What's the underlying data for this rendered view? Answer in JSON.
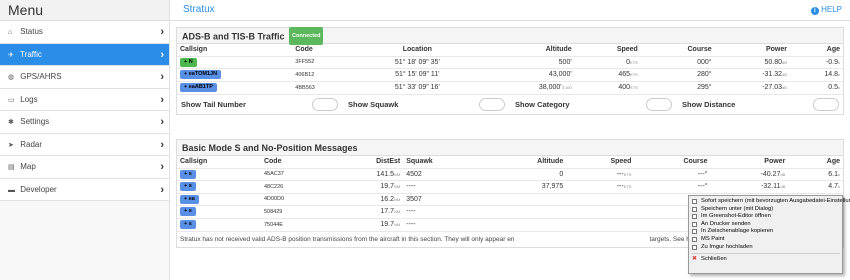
{
  "sidebar": {
    "title": "Menu",
    "items": [
      {
        "label": "Status",
        "icon": "home-icon",
        "glyph": "⌂",
        "active": false
      },
      {
        "label": "Traffic",
        "icon": "plane-icon",
        "glyph": "✈",
        "active": true
      },
      {
        "label": "GPS/AHRS",
        "icon": "globe-icon",
        "glyph": "◍",
        "active": false
      },
      {
        "label": "Logs",
        "icon": "file-icon",
        "glyph": "▭",
        "active": false
      },
      {
        "label": "Settings",
        "icon": "gear-icon",
        "glyph": "✱",
        "active": false
      },
      {
        "label": "Radar",
        "icon": "location-arrow-icon",
        "glyph": "➤",
        "active": false
      },
      {
        "label": "Map",
        "icon": "map-icon",
        "glyph": "▤",
        "active": false
      },
      {
        "label": "Developer",
        "icon": "terminal-icon",
        "glyph": "▬",
        "active": false
      }
    ],
    "chevron": "›"
  },
  "header": {
    "title": "Stratux",
    "help_label": "HELP",
    "help_glyph": "i"
  },
  "adsb": {
    "title": "ADS-B and TIS-B Traffic",
    "status_badge": "Connected",
    "columns": [
      "Callsign",
      "Code",
      "Location",
      "Altitude",
      "Speed",
      "Course",
      "Power",
      "Age"
    ],
    "rows": [
      {
        "callsign": "+ N",
        "color": "green",
        "code": "3FF552",
        "location": "51° 18' 09\" 35'",
        "altitude": "500'",
        "alt_extra": "",
        "speed": "0",
        "course": "000°",
        "power": "50.80",
        "age": "-0.9"
      },
      {
        "callsign": "+ eaTOM1JN",
        "color": "blue",
        "code": "406B12",
        "location": "51° 15' 09\" 11'",
        "altitude": "43,000'",
        "alt_extra": "",
        "speed": "465",
        "course": "280°",
        "power": "-31.32",
        "age": "14.8"
      },
      {
        "callsign": "+ eaAB1TP",
        "color": "blue",
        "code": "4BB563",
        "location": "51° 33' 09\" 16'",
        "altitude": "38,000'",
        "alt_extra": "⇕100",
        "speed": "400",
        "course": "295°",
        "power": "-27.03",
        "age": "0.5"
      }
    ],
    "toggles": [
      "Show Tail Number",
      "Show Squawk",
      "Show Category",
      "Show Distance"
    ],
    "units": {
      "speed": "KTS",
      "power": "dB",
      "age": "s"
    }
  },
  "modes": {
    "title": "Basic Mode S and No-Position Messages",
    "columns": [
      "Callsign",
      "Code",
      "DistEst",
      "Squawk",
      "Altitude",
      "Speed",
      "Course",
      "Power",
      "Age"
    ],
    "rows": [
      {
        "callsign": "+ s",
        "code": "45AC37",
        "dist": "141.5",
        "squawk": "4502",
        "altitude": "0",
        "speed": "---",
        "course": "---°",
        "power": "-40.27",
        "age": "6.1"
      },
      {
        "callsign": "+ s",
        "code": "48C226",
        "dist": "19.7",
        "squawk": "----",
        "altitude": "37,975",
        "speed": "---",
        "course": "---°",
        "power": "-32.11",
        "age": "4.7"
      },
      {
        "callsign": "+ ea",
        "code": "4D00D0",
        "dist": "16.2",
        "squawk": "3507",
        "altitude": "",
        "speed": "",
        "course": "030°",
        "power": "-30.44",
        "age": "19.0"
      },
      {
        "callsign": "+ s",
        "code": "508429",
        "dist": "17.7",
        "squawk": "----",
        "altitude": "",
        "speed": "",
        "course": "---°",
        "power": "-31.20",
        "age": "36.4"
      },
      {
        "callsign": "+ s",
        "code": "75044E",
        "dist": "19.7",
        "squawk": "----",
        "altitude": "",
        "speed": "",
        "course": "---°",
        "power": "-31.12",
        "age": "18.8"
      }
    ],
    "dist_unit": "NM",
    "note": "Stratux has not received valid ADS-B position transmissions from the aircraft in this section. They will only appear en",
    "note_tail": "targets. See help page for details."
  },
  "context_menu": {
    "items": [
      "Sofort speichern (mit bevorzugten Ausgabedatei-Einstellungen)",
      "Speichern unter (mit Dialog)",
      "Im Greenshot-Editor öffnen",
      "An Drucker senden",
      "In Zwischenablage kopieren",
      "MS Paint",
      "Zu Imgur hochladen"
    ],
    "close_label": "Schließen",
    "close_glyph": "✕"
  }
}
